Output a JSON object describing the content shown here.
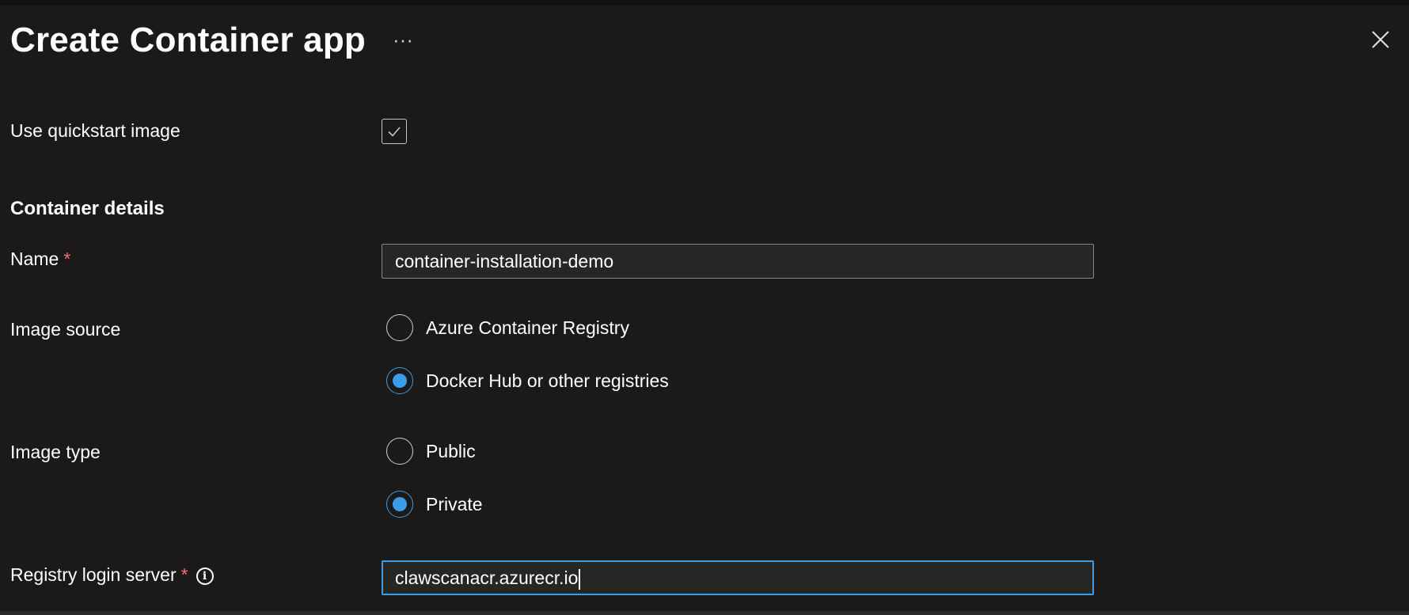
{
  "header": {
    "title": "Create Container app",
    "more_label": "···"
  },
  "quickstart": {
    "label": "Use quickstart image",
    "checked": true
  },
  "container_details": {
    "section_title": "Container details",
    "name": {
      "label": "Name",
      "required_mark": "*",
      "value": "container-installation-demo"
    },
    "image_source": {
      "label": "Image source",
      "options": [
        "Azure Container Registry",
        "Docker Hub or other registries"
      ],
      "selected": "Docker Hub or other registries"
    },
    "image_type": {
      "label": "Image type",
      "options": [
        "Public",
        "Private"
      ],
      "selected": "Private"
    },
    "registry_login_server": {
      "label": "Registry login server",
      "required_mark": "*",
      "info_icon": "i",
      "value": "clawscanacr.azurecr.io"
    }
  },
  "colors": {
    "background": "#1b1a19",
    "accent": "#3b9ce8",
    "required": "#f1707b"
  }
}
